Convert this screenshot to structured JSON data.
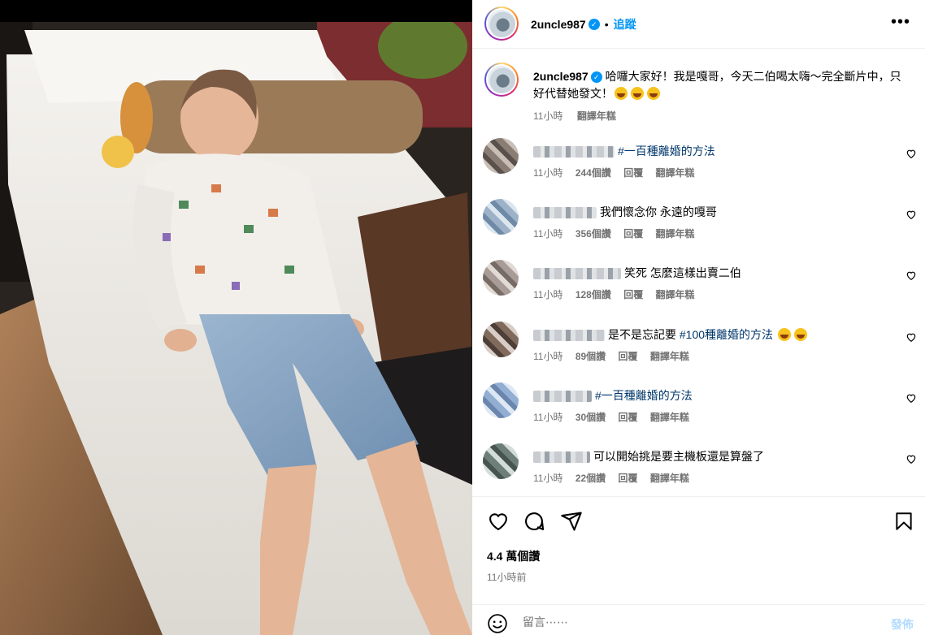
{
  "header": {
    "username": "2uncle987",
    "separator": "•",
    "follow_label": "追蹤",
    "more_icon": "more-icon",
    "more_label": "•••"
  },
  "caption": {
    "username": "2uncle987",
    "text": "哈囉大家好！我是嘎哥，今天二伯喝太嗨～完全斷片中，只好代替她發文！",
    "emojis": [
      "laughing-emoji",
      "laughing-emoji",
      "laughing-emoji"
    ],
    "time": "11小時",
    "translate": "翻譯年糕"
  },
  "comments": [
    {
      "text": "#一百種離婚的方法",
      "time": "11小時",
      "likes": "244個讚",
      "reply": "回覆",
      "translate": "翻譯年糕",
      "avatar_color": "#8a7d74"
    },
    {
      "text": "我們懷念你 永遠的嘎哥",
      "time": "11小時",
      "likes": "356個讚",
      "reply": "回覆",
      "translate": "翻譯年糕",
      "avatar_color": "#9db2c8"
    },
    {
      "text": "笑死 怎麼這樣出賣二伯",
      "time": "11小時",
      "likes": "128個讚",
      "reply": "回覆",
      "translate": "翻譯年糕",
      "avatar_color": "#a99c96"
    },
    {
      "text_plain": "是不是忘記要 ",
      "text_tag": "#100種離婚的方法",
      "time": "11小時",
      "likes": "89個讚",
      "reply": "回覆",
      "translate": "翻譯年糕",
      "avatar_color": "#7f6a5c"
    },
    {
      "text": "#一百種離婚的方法",
      "time": "11小時",
      "likes": "30個讚",
      "reply": "回覆",
      "translate": "翻譯年糕",
      "avatar_color": "#93aed3"
    },
    {
      "text": "可以開始挑是要主機板還是算盤了",
      "time": "11小時",
      "likes": "22個讚",
      "reply": "回覆",
      "translate": "翻譯年糕",
      "avatar_color": "#6e7f7a"
    }
  ],
  "actions": {
    "like_icon": "heart-icon",
    "comment_icon": "comment-icon",
    "share_icon": "share-icon",
    "save_icon": "bookmark-icon",
    "likes": "4.4 萬個讚",
    "time": "11小時前"
  },
  "comment_bar": {
    "emoji_icon": "smiley-icon",
    "placeholder": "留言⋯⋯",
    "post_label": "發佈"
  },
  "colors": {
    "accent": "#0095f6",
    "hashtag": "#00376b",
    "muted": "#737373"
  }
}
